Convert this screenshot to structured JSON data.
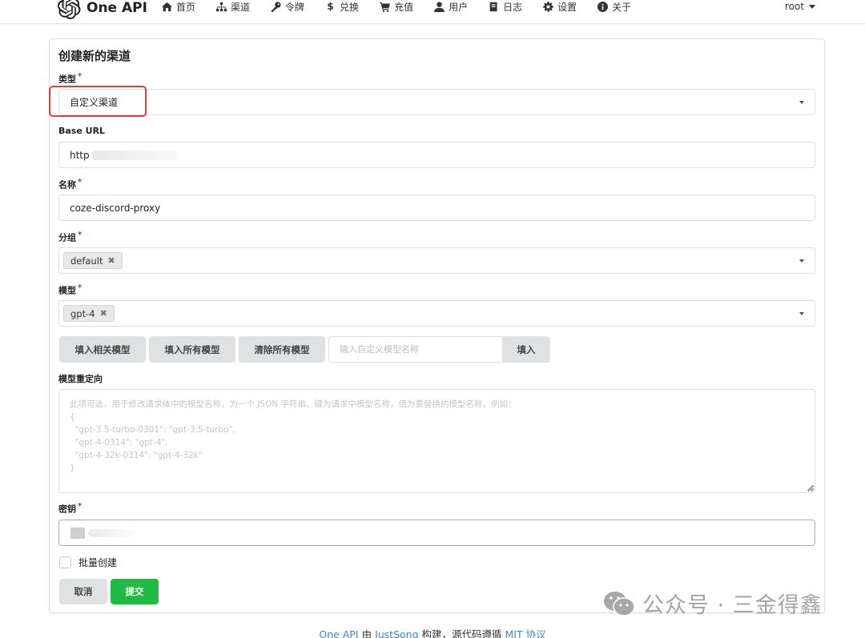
{
  "app": {
    "logo_text": "One API"
  },
  "nav": {
    "items": [
      {
        "label": "首页",
        "icon": "home-icon"
      },
      {
        "label": "渠道",
        "icon": "sitemap-icon"
      },
      {
        "label": "令牌",
        "icon": "key-icon"
      },
      {
        "label": "兑换",
        "icon": "dollar-icon"
      },
      {
        "label": "充值",
        "icon": "cart-icon"
      },
      {
        "label": "用户",
        "icon": "user-icon"
      },
      {
        "label": "日志",
        "icon": "book-icon"
      },
      {
        "label": "设置",
        "icon": "gear-icon"
      },
      {
        "label": "关于",
        "icon": "info-icon"
      }
    ],
    "user": "root"
  },
  "form": {
    "title": "创建新的渠道",
    "type": {
      "label": "类型",
      "value": "自定义渠道"
    },
    "base_url": {
      "label": "Base URL",
      "value": "http"
    },
    "name": {
      "label": "名称",
      "value": "coze-discord-proxy"
    },
    "group": {
      "label": "分组",
      "tag": "default"
    },
    "model": {
      "label": "模型",
      "tag": "gpt-4"
    },
    "buttons": {
      "fill_related": "填入相关模型",
      "fill_all": "填入所有模型",
      "clear_all": "清除所有模型",
      "custom_placeholder": "输入自定义模型名称",
      "fill": "填入"
    },
    "model_mapping": {
      "label": "模型重定向",
      "placeholder": "此项可选，用于修改请求体中的模型名称，为一个 JSON 字符串，键为请求中模型名称，值为要替换的模型名称，例如：\n{\n  \"gpt-3.5-turbo-0301\": \"gpt-3.5-turbo\",\n  \"gpt-4-0314\": \"gpt-4\",\n  \"gpt-4-32k-0314\": \"gpt-4-32k\"\n}"
    },
    "key": {
      "label": "密钥"
    },
    "batch": {
      "label": "批量创建"
    },
    "cancel": "取消",
    "submit": "提交"
  },
  "watermark": "公众号 · 三金得鑫",
  "footer": {
    "project": "One API",
    "by": " 由 ",
    "author": "JustSong",
    "middle": " 构建，源代码遵循 ",
    "license": "MIT 协议"
  },
  "colors": {
    "accent_green": "#21ba45",
    "highlight_red": "#e0403a",
    "link": "#4183c4"
  }
}
